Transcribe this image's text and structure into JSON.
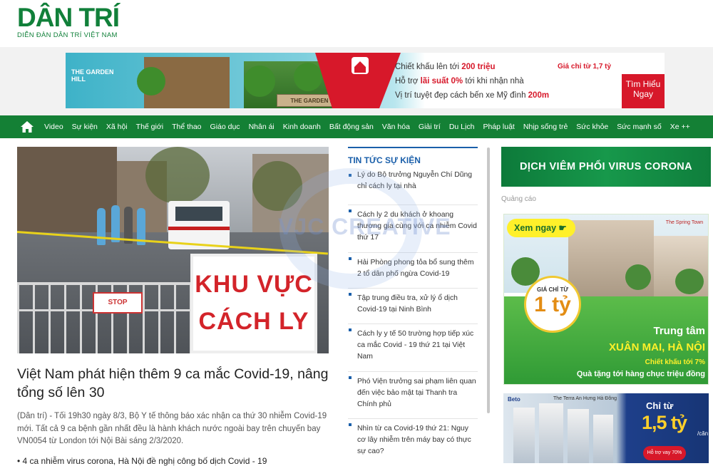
{
  "header": {
    "logo_text": "DÂN TRÍ",
    "logo_subtitle": "DIỄN ĐÀN DÂN TRÍ VIỆT NAM"
  },
  "top_banner": {
    "project_logo": "THE GARDEN HILL",
    "sign_text": "THE GARDEN HILL",
    "line1_prefix": "Chiết khấu lên tới ",
    "line1_highlight": "200 triệu",
    "line2_prefix": "Hỗ trợ ",
    "line2_highlight": "lãi suất 0%",
    "line2_suffix": " tới khi nhận nhà",
    "line3_prefix": "Vị trí tuyệt đẹp cách bến xe Mỹ đình ",
    "line3_highlight": "200m",
    "price_tag": "Giá chỉ từ 1,7 tỷ",
    "cta": "Tìm Hiểu Ngay"
  },
  "nav": {
    "home_icon": "home-icon",
    "items": [
      "Video",
      "Sự kiện",
      "Xã hội",
      "Thế giới",
      "Thể thao",
      "Giáo dục",
      "Nhân ái",
      "Kinh doanh",
      "Bất động sản",
      "Văn hóa",
      "Giải trí",
      "Du Lịch",
      "Pháp luật",
      "Nhịp sống trẻ",
      "Sức khỏe",
      "Sức mạnh số",
      "Xe ++"
    ]
  },
  "main_article": {
    "image_sign_line1": "KHU VỰC",
    "image_sign_line2": "CÁCH LY",
    "image_stop_sign": "STOP",
    "title": "Việt Nam phát hiện thêm 9 ca mắc Covid-19, nâng tổng số lên 30",
    "summary": "(Dân trí) - Tối 19h30 ngày 8/3, Bộ Y tế thông báo xác nhận ca thứ 30 nhiễm Covid-19 mới. Tất cả 9 ca bệnh gần nhất đều là hành khách nước ngoài bay trên chuyến bay VN0054 từ London tới Nội Bài sáng 2/3/2020.",
    "related": "• 4 ca nhiễm virus corona, Hà Nội đề nghị công bố dịch Covid - 19"
  },
  "news_column": {
    "heading": "TIN TỨC SỰ KIỆN",
    "items": [
      "Lý do Bộ trưởng Nguyễn Chí Dũng chỉ cách ly tại nhà",
      "Cách ly 2 du khách ở khoang thương gia cùng với ca nhiễm Covid thứ 17",
      "Hải Phòng phong tỏa bổ sung thêm 2 tổ dân phố ngừa Covid-19",
      "Tập trung điều tra, xử lý ổ dịch Covid-19 tại Ninh Bình",
      "Cách ly y tế 50 trường hợp tiếp xúc ca mắc Covid - 19 thứ 21 tại Việt Nam",
      "Phó Viện trưởng sai phạm liên quan đến việc bảo mật tại Thanh tra Chính phủ",
      "Nhìn từ ca Covid-19 thứ 21: Nguy cơ lây nhiễm trên máy bay có thực sự cao?"
    ]
  },
  "sidebar": {
    "corona_banner": "DỊCH VIÊM PHỔI VIRUS CORONA",
    "ad_label": "Quảng cáo",
    "ad1": {
      "button": "Xem ngay",
      "brand": "The Spring Town",
      "price_small": "GIÁ CHỈ TỪ",
      "price_big": "1 tỷ",
      "line1": "Trung tâm",
      "line2": "XUÂN MAI, HÀ NỘI",
      "line3": "Chiết khấu tới 7%",
      "line4": "Quà tặng tới hàng chục triệu đồng"
    },
    "ad2": {
      "brand": "Beto",
      "project": "The Terra An Hưng Hà Đông",
      "label": "Chỉ từ",
      "price": "1,5 tỷ",
      "unit": "/căn",
      "promo": "Hỗ trợ vay 70%"
    }
  },
  "watermark": "VJC CREATIVE",
  "colors": {
    "brand_green": "#148035",
    "link_blue": "#1a5faa",
    "alert_red": "#d3242a"
  }
}
